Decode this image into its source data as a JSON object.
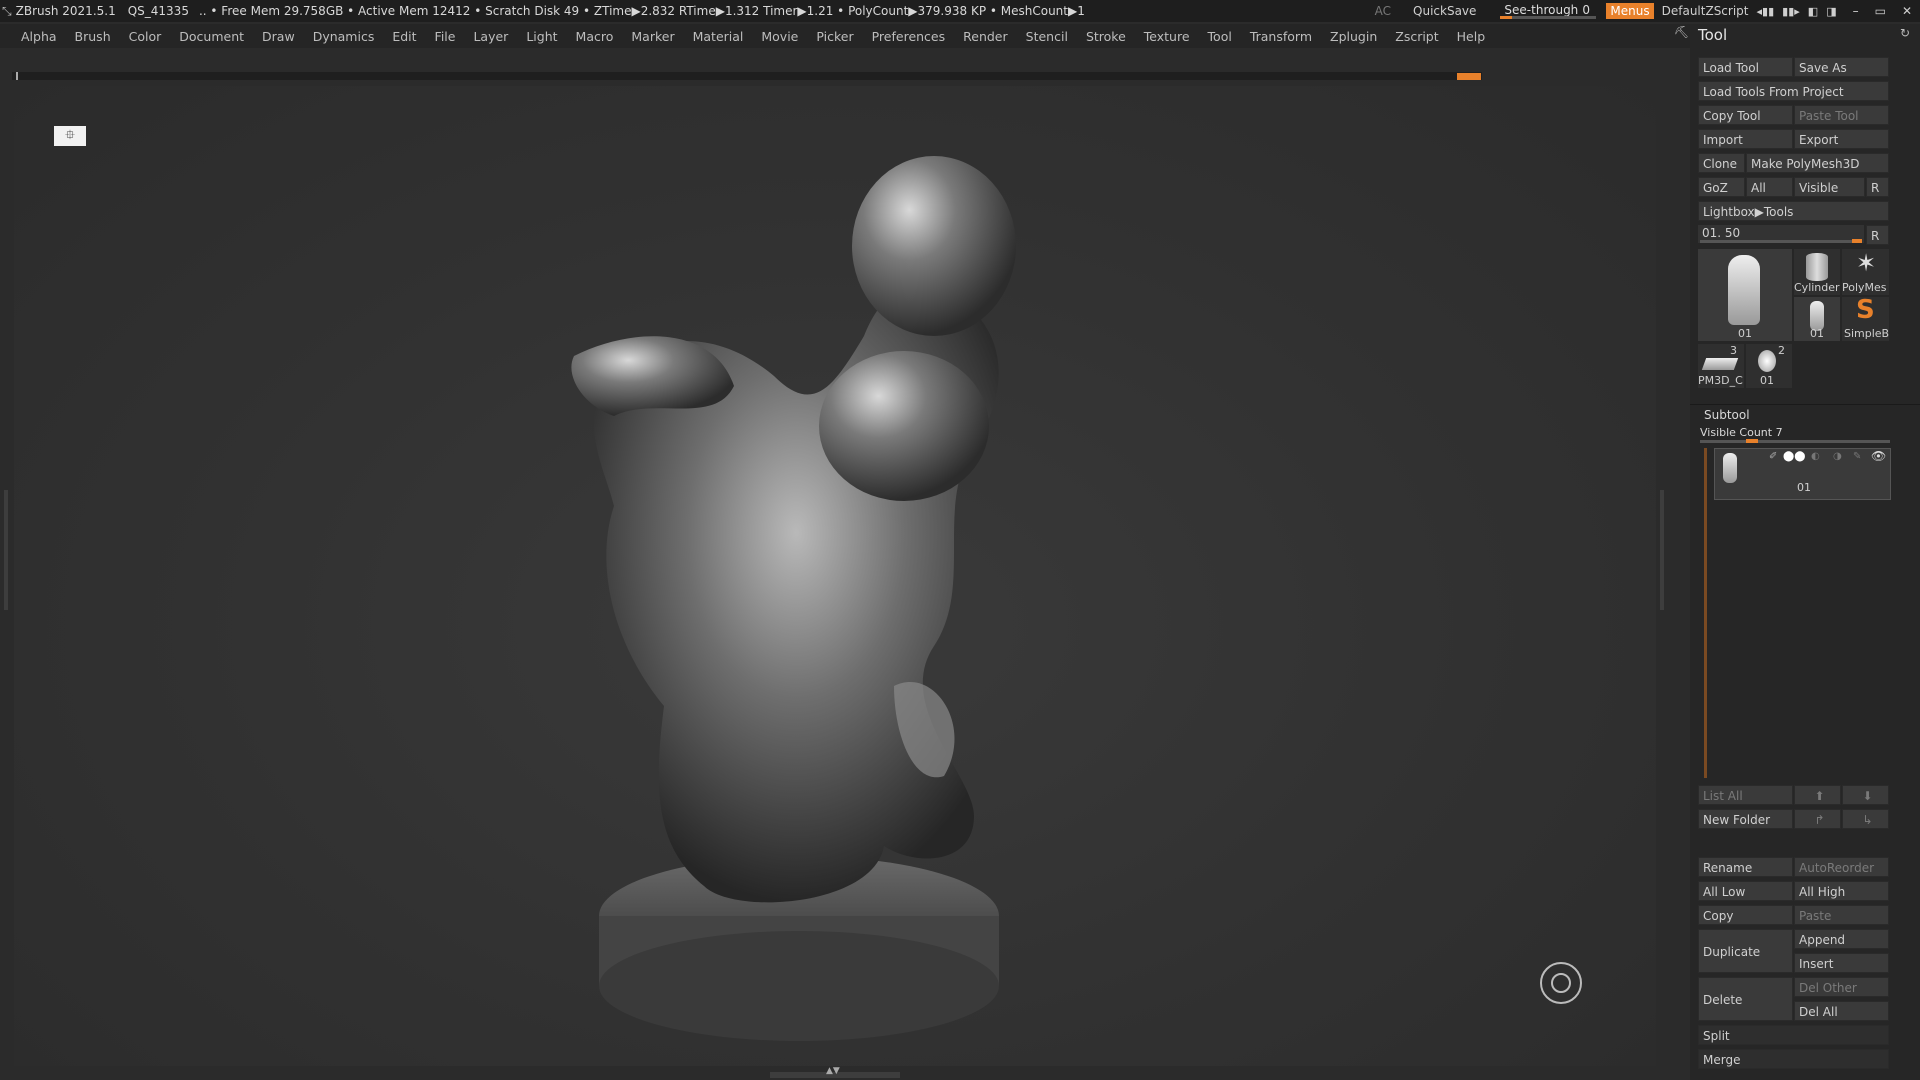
{
  "titlebar": {
    "app": "ZBrush 2021.5.1",
    "project": "QS_41335",
    "stats": ".. • Free Mem 29.758GB • Active Mem 12412 • Scratch Disk 49 • ZTime▶2.832 RTime▶1.312 Timer▶1.21 • PolyCount▶379.938 KP • MeshCount▶1",
    "ac": "AC",
    "quicksave": "QuickSave",
    "see_through_label": "See-through",
    "see_through_value": "0",
    "menus": "Menus",
    "script": "DefaultZScript"
  },
  "menubar": [
    "Alpha",
    "Brush",
    "Color",
    "Document",
    "Draw",
    "Dynamics",
    "Edit",
    "File",
    "Layer",
    "Light",
    "Macro",
    "Marker",
    "Material",
    "Movie",
    "Picker",
    "Preferences",
    "Render",
    "Stencil",
    "Stroke",
    "Texture",
    "Tool",
    "Transform",
    "Zplugin",
    "Zscript",
    "Help"
  ],
  "tool": {
    "title": "Tool",
    "load_tool": "Load Tool",
    "save_as": "Save As",
    "load_from_project": "Load Tools From Project",
    "copy_tool": "Copy Tool",
    "paste_tool": "Paste Tool",
    "import": "Import",
    "export": "Export",
    "clone": "Clone",
    "make_polymesh": "Make PolyMesh3D",
    "goz": "GoZ",
    "all": "All",
    "visible": "Visible",
    "r": "R",
    "lightbox_tools": "Lightbox▶Tools",
    "slider_label": "01. 50",
    "slider_r": "R",
    "thumbs": {
      "main": "01",
      "cylinder": "Cylinder",
      "polymesh": "PolyMes",
      "small01": "01",
      "simpleb": "SimpleB",
      "pm3d": "PM3D_C",
      "pm3d_num": "3",
      "head": "01",
      "head_num": "2"
    }
  },
  "subtool": {
    "title": "Subtool",
    "visible_count": "Visible Count 7",
    "item_label": "01",
    "list_all": "List All",
    "new_folder": "New Folder",
    "rename": "Rename",
    "auto_reorder": "AutoReorder",
    "all_low": "All Low",
    "all_high": "All High",
    "copy": "Copy",
    "paste": "Paste",
    "duplicate": "Duplicate",
    "append": "Append",
    "insert": "Insert",
    "delete": "Delete",
    "del_other": "Del Other",
    "del_all": "Del All",
    "split": "Split",
    "merge": "Merge"
  },
  "colors": {
    "accent": "#e8812b",
    "panel": "#262626",
    "button": "#3a3a3a",
    "canvas": "#313131"
  }
}
